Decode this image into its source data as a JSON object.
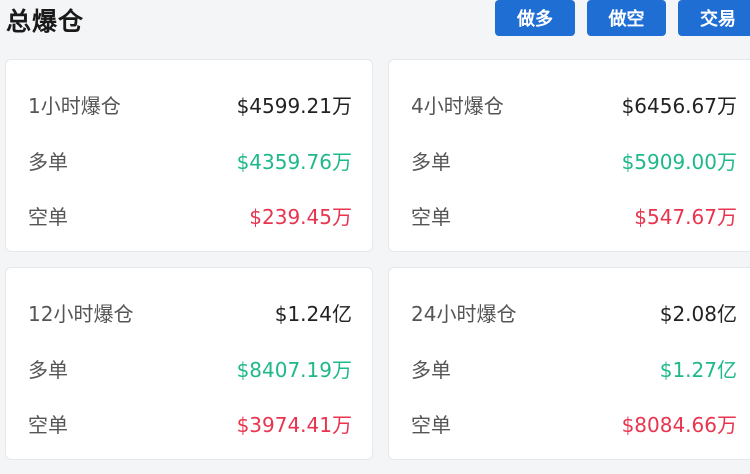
{
  "header": {
    "title": "总爆仓",
    "buttons": {
      "long": "做多",
      "short": "做空",
      "trade": "交易"
    }
  },
  "cards": [
    {
      "period": "1小时爆仓",
      "total": "$4599.21万",
      "long_label": "多单",
      "long": "$4359.76万",
      "short_label": "空单",
      "short": "$239.45万"
    },
    {
      "period": "4小时爆仓",
      "total": "$6456.67万",
      "long_label": "多单",
      "long": "$5909.00万",
      "short_label": "空单",
      "short": "$547.67万"
    },
    {
      "period": "12小时爆仓",
      "total": "$1.24亿",
      "long_label": "多单",
      "long": "$8407.19万",
      "short_label": "空单",
      "short": "$3974.41万"
    },
    {
      "period": "24小时爆仓",
      "total": "$2.08亿",
      "long_label": "多单",
      "long": "$1.27亿",
      "short_label": "空单",
      "short": "$8084.66万"
    }
  ],
  "colors": {
    "accent": "#1f6ed4",
    "long": "#1fb88a",
    "short": "#e8344e"
  }
}
